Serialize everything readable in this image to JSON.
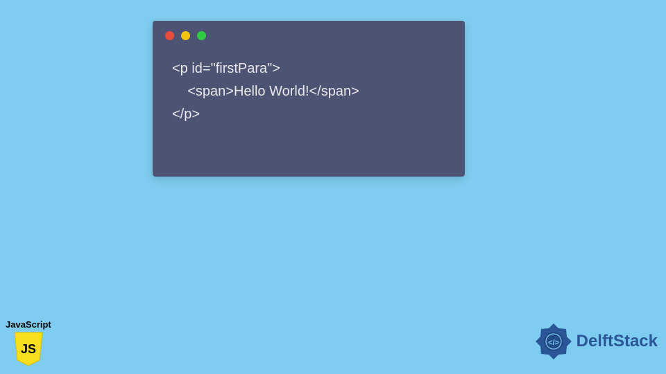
{
  "codeWindow": {
    "trafficLights": {
      "red": "#e74c3c",
      "yellow": "#f1c40f",
      "green": "#2ecc40"
    },
    "code": {
      "line1": "<p id=\"firstPara\">",
      "line2": "    <span>Hello World!</span>",
      "line3": "</p>"
    }
  },
  "jsBadge": {
    "label": "JavaScript",
    "logoText": "JS"
  },
  "delftLogo": {
    "text": "DelftStack"
  }
}
